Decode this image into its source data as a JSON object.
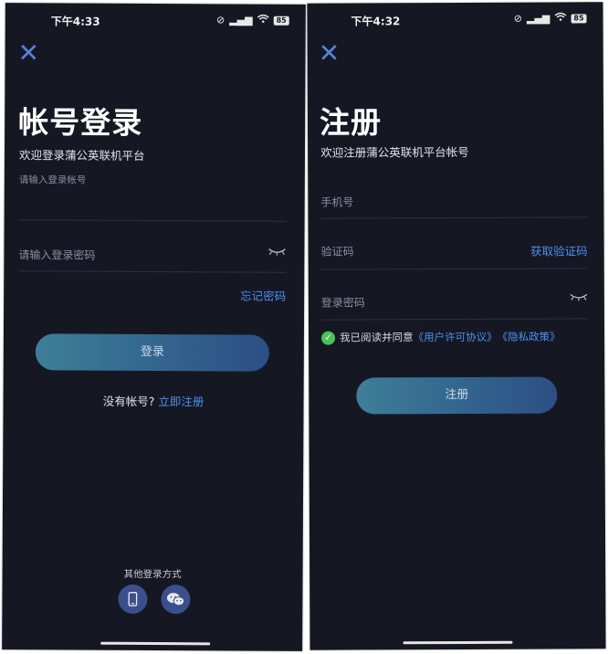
{
  "login": {
    "status_time": "下午4:33",
    "battery": "85",
    "title": "帐号登录",
    "subtitle": "欢迎登录蒲公英联机平台",
    "account_placeholder": "请输入登录帐号",
    "password_placeholder": "请输入登录密码",
    "forgot": "忘记密码",
    "login_button": "登录",
    "no_account": "没有帐号?",
    "register_link": "立即注册",
    "other_methods": "其他登录方式"
  },
  "register": {
    "status_time": "下午4:32",
    "battery": "85",
    "title": "注册",
    "subtitle": "欢迎注册蒲公英联机平台帐号",
    "phone_placeholder": "手机号",
    "code_placeholder": "验证码",
    "get_code": "获取验证码",
    "password_placeholder": "登录密码",
    "agree_text": "我已阅读并同意",
    "license_link": "《用户许可协议》",
    "privacy_link": "《隐私政策》",
    "register_button": "注册"
  },
  "colors": {
    "background": "#151823",
    "accent_blue": "#4e8ff0",
    "button_gradient_start": "#3f7e98",
    "button_gradient_end": "#2d4f84",
    "check_green": "#4cc05a"
  },
  "icons": [
    "close-icon",
    "eye-closed-icon",
    "phone-icon",
    "wechat-icon",
    "wifi-icon",
    "signal-icon",
    "battery-icon"
  ]
}
